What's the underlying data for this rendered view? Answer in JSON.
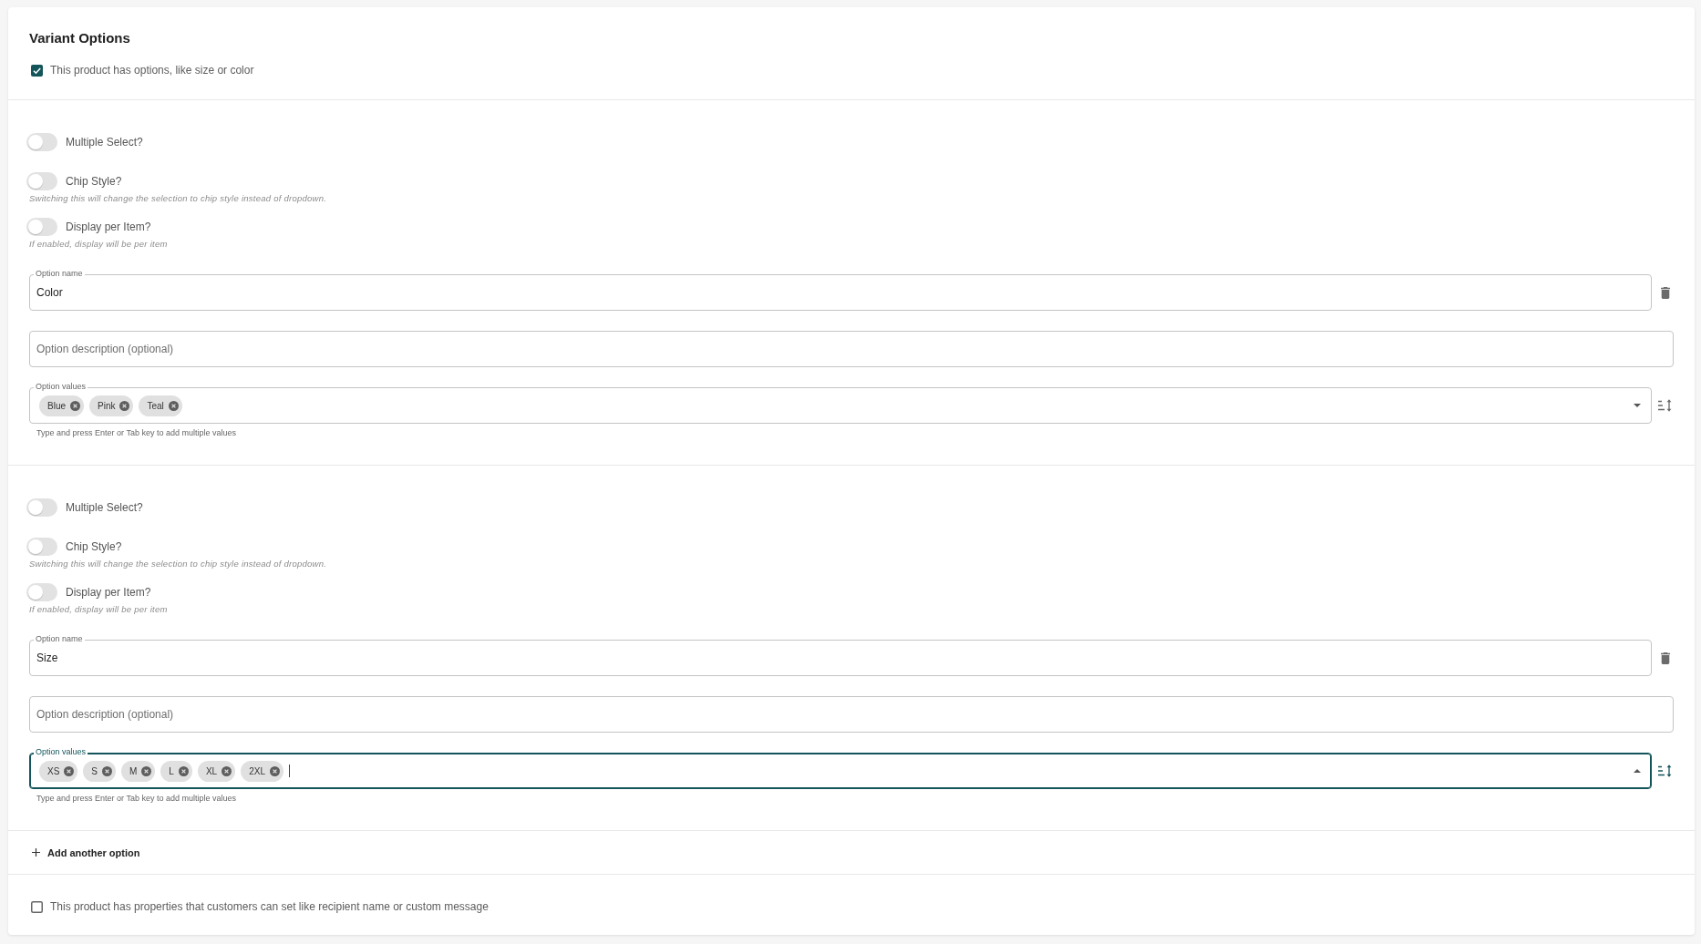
{
  "variant_options": {
    "title": "Variant Options",
    "has_options": {
      "label": "This product has options, like size or color",
      "checked": true
    }
  },
  "options": [
    {
      "toggles": [
        {
          "label": "Multiple Select?",
          "on": false
        },
        {
          "label": "Chip Style?",
          "on": false,
          "hint": "Switching this will change the selection to chip style instead of dropdown."
        },
        {
          "label": "Display per Item?",
          "on": false,
          "hint": "If enabled, display will be per item"
        }
      ],
      "option_name": {
        "label": "Option name",
        "value": "Color"
      },
      "option_description": {
        "placeholder": "Option description (optional)"
      },
      "option_values": {
        "label": "Option values",
        "chips": [
          "Blue",
          "Pink",
          "Teal"
        ],
        "focused": false,
        "expanded": false,
        "helper": "Type and press Enter or Tab key to add multiple values"
      }
    },
    {
      "toggles": [
        {
          "label": "Multiple Select?",
          "on": false
        },
        {
          "label": "Chip Style?",
          "on": false,
          "hint": "Switching this will change the selection to chip style instead of dropdown."
        },
        {
          "label": "Display per Item?",
          "on": false,
          "hint": "If enabled, display will be per item"
        }
      ],
      "option_name": {
        "label": "Option name",
        "value": "Size"
      },
      "option_description": {
        "placeholder": "Option description (optional)"
      },
      "option_values": {
        "label": "Option values",
        "chips": [
          "XS",
          "S",
          "M",
          "L",
          "XL",
          "2XL"
        ],
        "focused": true,
        "expanded": true,
        "helper": "Type and press Enter or Tab key to add multiple values"
      }
    }
  ],
  "add_option": {
    "label": "Add another option"
  },
  "properties": {
    "label": "This product has properties that customers can set like recipient name or custom message",
    "checked": false
  }
}
